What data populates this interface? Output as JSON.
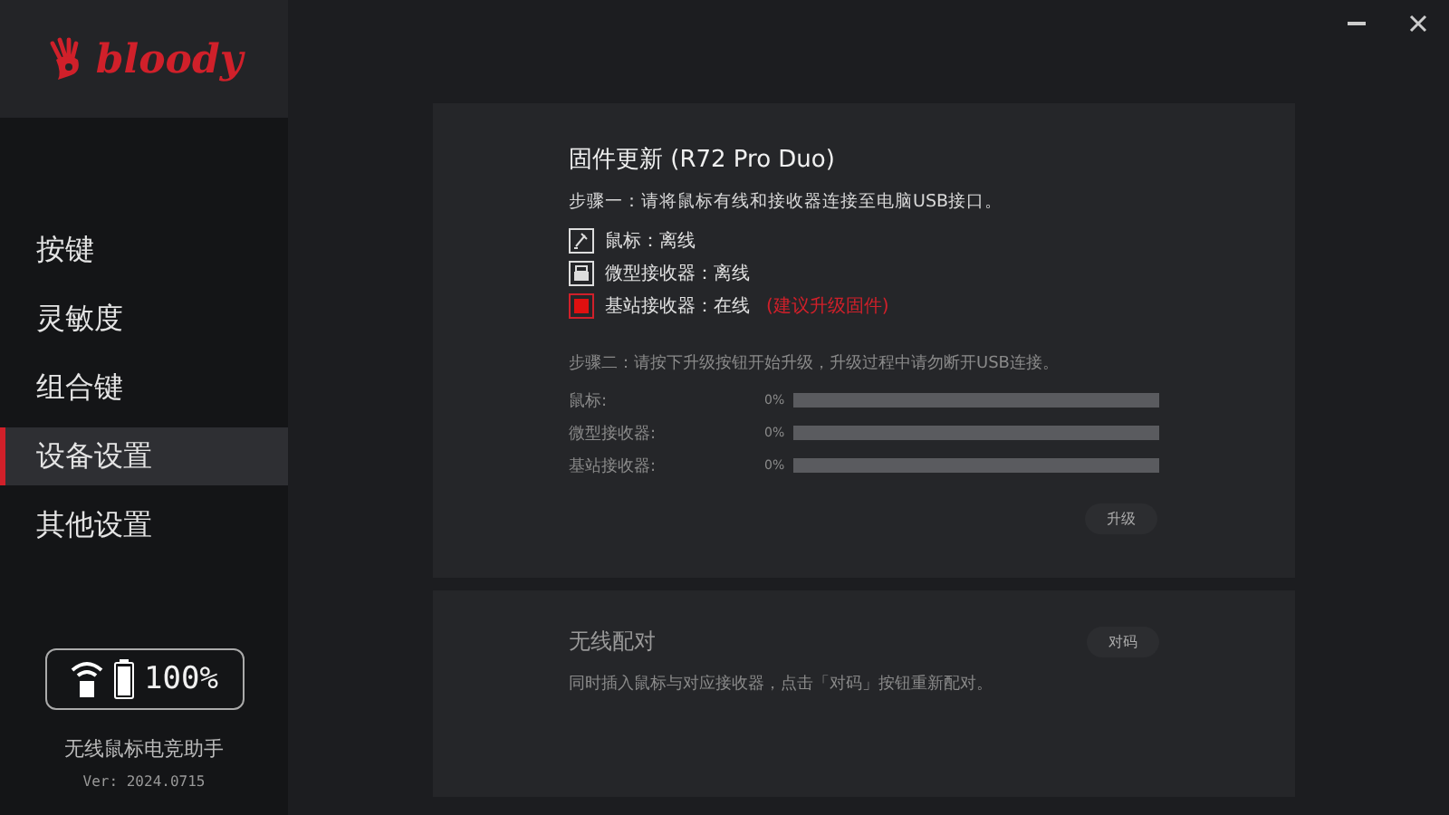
{
  "logo": "bloody",
  "window_controls": [
    {
      "kind": "minimize"
    },
    {
      "kind": "close"
    }
  ],
  "sidebar": {
    "items": [
      {
        "label": "按键",
        "selected": false
      },
      {
        "label": "灵敏度",
        "selected": false
      },
      {
        "label": "组合键",
        "selected": false
      },
      {
        "label": "设备设置",
        "selected": true
      },
      {
        "label": "其他设置",
        "selected": false
      }
    ],
    "battery": {
      "reading": "100%"
    },
    "app_name": "无线鼠标电竞助手",
    "version": "Ver: 2024.0715"
  },
  "firmware": {
    "title": "固件更新 (R72 Pro Duo)",
    "step1": "步骤一：请将鼠标有线和接收器连接至电脑USB接口。",
    "devices": [
      {
        "kind": "mouse",
        "label": "鼠标：离线",
        "online": false
      },
      {
        "kind": "receiver",
        "label": "微型接收器：离线",
        "online": false
      },
      {
        "kind": "base",
        "label": "基站接收器：在线",
        "online": true,
        "note": "(建议升级固件)"
      }
    ],
    "step2": "步骤二：请按下升级按钮开始升级，升级过程中请勿断开USB连接。",
    "progress": [
      {
        "label": "鼠标:",
        "reading": "0%",
        "level": 0
      },
      {
        "label": "微型接收器:",
        "reading": "0%",
        "level": 0
      },
      {
        "label": "基站接收器:",
        "reading": "0%",
        "level": 0
      }
    ],
    "button": "升级"
  },
  "pairing": {
    "title": "无线配对",
    "button": "对码",
    "description": "同时插入鼠标与对应接收器，点击「对码」按钮重新配对。"
  }
}
